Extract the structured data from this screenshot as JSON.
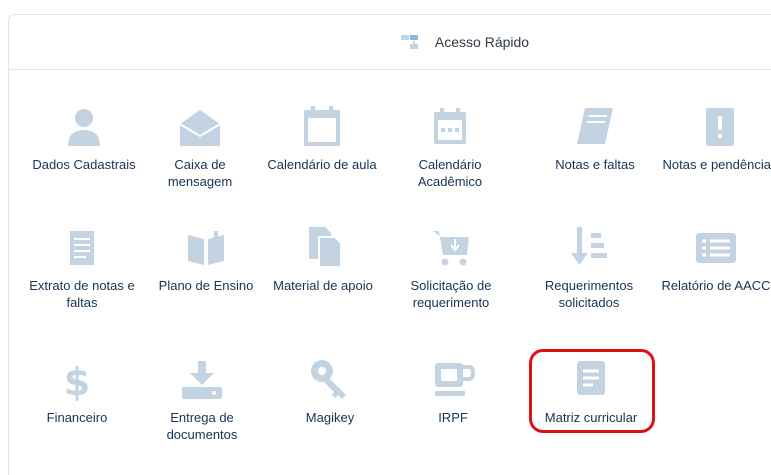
{
  "header": {
    "title": "Acesso Rápido",
    "icon": "sitemap-icon"
  },
  "colors": {
    "icon": "#c4d3e1",
    "text": "#163454",
    "highlight": "#e01010",
    "border": "#e3e6e9"
  },
  "tiles": [
    {
      "label": "Dados Cadastrais",
      "icon": "user-icon"
    },
    {
      "label": "Caixa de mensagem",
      "icon": "envelope-icon"
    },
    {
      "label": "Calendário de aula",
      "icon": "calendar-icon"
    },
    {
      "label": "Calendário Acadêmico",
      "icon": "calendar-dots-icon"
    },
    {
      "label": "Notas e faltas",
      "icon": "book-icon"
    },
    {
      "label": "Notas e pendências",
      "icon": "clipboard-alert-icon"
    },
    {
      "label": "Extrato de notas e faltas",
      "icon": "document-list-icon"
    },
    {
      "label": "Plano de Ensino",
      "icon": "open-book-icon"
    },
    {
      "label": "Material de apoio",
      "icon": "files-icon"
    },
    {
      "label": "Solicitação de requerimento",
      "icon": "cart-icon"
    },
    {
      "label": "Requerimentos solicitados",
      "icon": "sort-list-icon"
    },
    {
      "label": "Relatório de AACC",
      "icon": "list-card-icon"
    },
    {
      "label": "Financeiro",
      "icon": "dollar-icon"
    },
    {
      "label": "Entrega de documentos",
      "icon": "download-tray-icon"
    },
    {
      "label": "Magikey",
      "icon": "key-icon"
    },
    {
      "label": "IRPF",
      "icon": "cup-icon"
    },
    {
      "label": "Matriz curricular",
      "icon": "document-lines-icon"
    }
  ]
}
